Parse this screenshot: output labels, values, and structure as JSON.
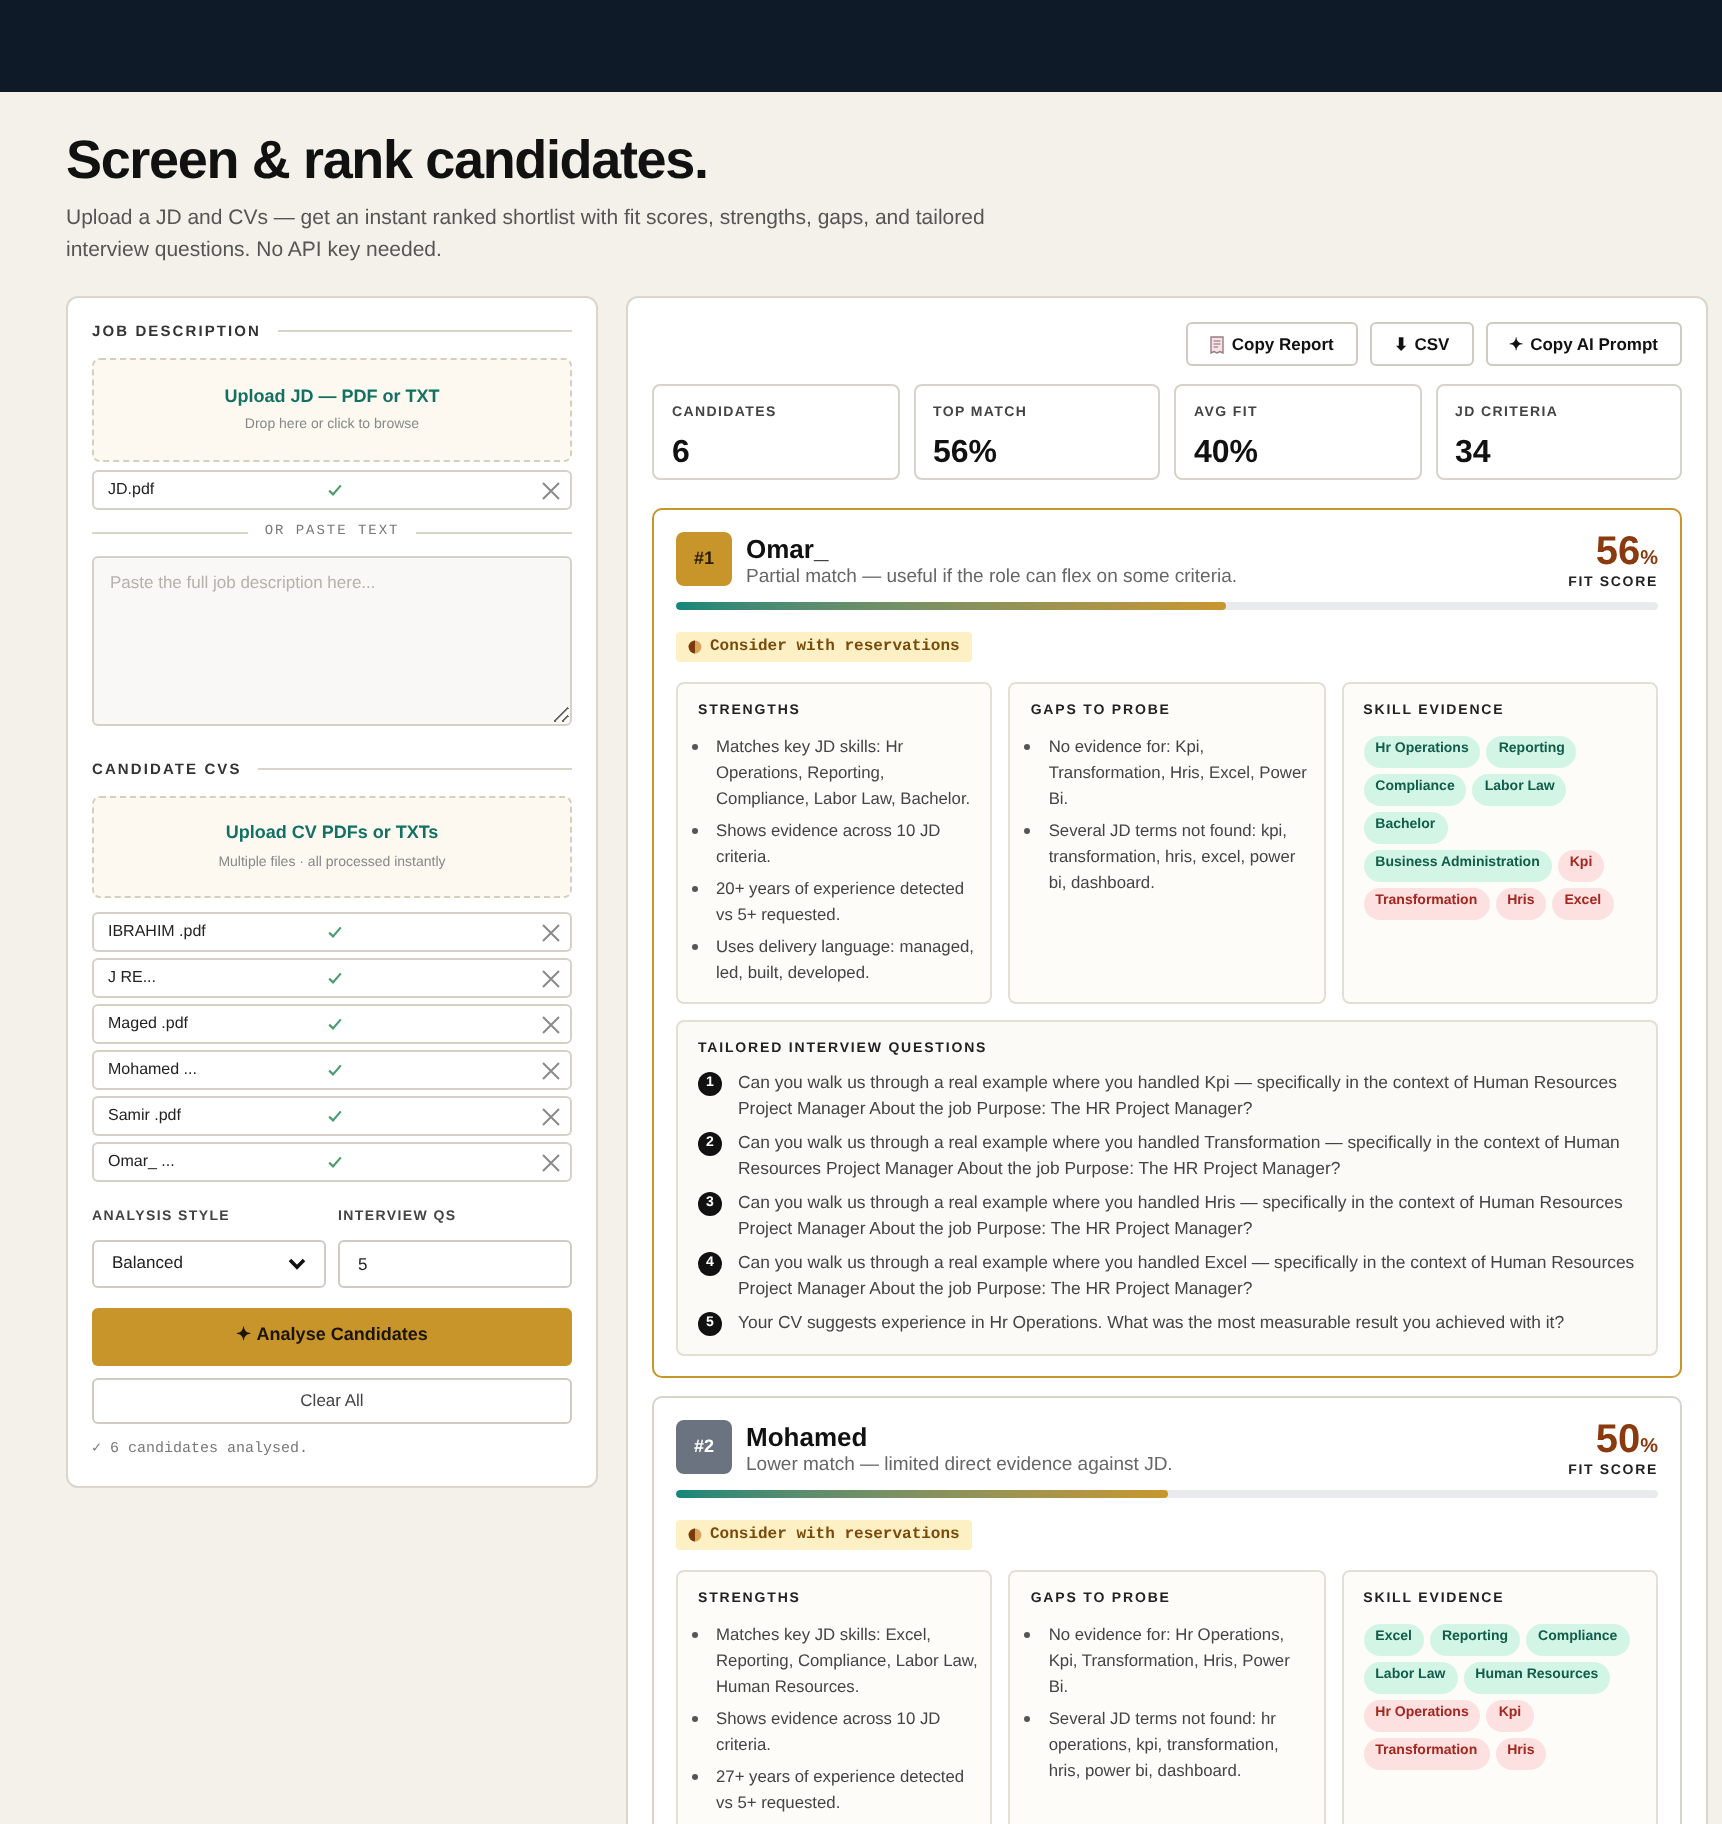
{
  "header": {
    "title": "Screen & rank candidates.",
    "subtitle": "Upload a JD and CVs — get an instant ranked shortlist with fit scores, strengths, gaps, and tailored interview questions. No API key needed."
  },
  "input_panel": {
    "jd_section": {
      "label": "JOB DESCRIPTION",
      "upload": {
        "title": "Upload JD — PDF or TXT",
        "hint": "Drop here or click to browse"
      },
      "files": [
        {
          "name": "JD.pdf",
          "processed": true
        }
      ],
      "divider": "OR PASTE TEXT",
      "textarea": {
        "placeholder": "Paste the full job description here..."
      }
    },
    "cv_section": {
      "label": "CANDIDATE CVS",
      "upload": {
        "title": "Upload CV PDFs or TXTs",
        "hint": "Multiple files · all processed instantly"
      },
      "files": [
        {
          "name": "IBRAHIM .pdf",
          "processed": true
        },
        {
          "name": "J RE...",
          "processed": true
        },
        {
          "name": "Maged .pdf",
          "processed": true
        },
        {
          "name": "Mohamed ...",
          "processed": true
        },
        {
          "name": "Samir .pdf",
          "processed": true
        },
        {
          "name": "Omar_ ...",
          "processed": true
        }
      ]
    },
    "analysis_style": {
      "label": "ANALYSIS STYLE",
      "value": "Balanced"
    },
    "interview_qs": {
      "label": "INTERVIEW QS",
      "value": "5"
    },
    "analyse_button": "✦ Analyse Candidates",
    "clear_button": "Clear All",
    "status": "✓ 6 candidates analysed."
  },
  "results": {
    "actions": [
      {
        "kind": "report",
        "label": "Copy Report"
      },
      {
        "kind": "plain",
        "label": "⬇ CSV"
      },
      {
        "kind": "plain",
        "label": "✦ Copy AI Prompt"
      }
    ],
    "stats": [
      {
        "label": "CANDIDATES",
        "value": "6"
      },
      {
        "label": "TOP MATCH",
        "value": "56%"
      },
      {
        "label": "AVG FIT",
        "value": "40%"
      },
      {
        "label": "JD CRITERIA",
        "value": "34"
      }
    ],
    "candidates": [
      {
        "rank": "#1",
        "highlighted": true,
        "name": "Omar_",
        "summary": "Partial match — useful if the role can flex on some criteria.",
        "score": "56",
        "score_unit": "%",
        "score_label": "FIT SCORE",
        "level": 0.56,
        "verdict": "Consider with reservations",
        "strengths": {
          "title": "STRENGTHS",
          "items": [
            "Matches key JD skills: Hr Operations, Reporting, Compliance, Labor Law, Bachelor.",
            "Shows evidence across 10 JD criteria.",
            "20+ years of experience detected vs 5+ requested.",
            "Uses delivery language: managed, led, built, developed."
          ]
        },
        "gaps": {
          "title": "GAPS TO PROBE",
          "items": [
            "No evidence for: Kpi, Transformation, Hris, Excel, Power Bi.",
            "Several JD terms not found: kpi, transformation, hris, excel, power bi, dashboard."
          ]
        },
        "skills": {
          "title": "SKILL EVIDENCE",
          "tags": [
            {
              "label": "Hr Operations",
              "found": true
            },
            {
              "label": "Reporting",
              "found": true
            },
            {
              "label": "Compliance",
              "found": true
            },
            {
              "label": "Labor Law",
              "found": true
            },
            {
              "label": "Bachelor",
              "found": true
            },
            {
              "label": "Business Administration",
              "found": true
            },
            {
              "label": "Kpi",
              "found": false
            },
            {
              "label": "Transformation",
              "found": false
            },
            {
              "label": "Hris",
              "found": false
            },
            {
              "label": "Excel",
              "found": false
            }
          ]
        },
        "questions": {
          "title": "TAILORED INTERVIEW QUESTIONS",
          "items": [
            {
              "number": "1",
              "text": "Can you walk us through a real example where you handled Kpi — specifically in the context of Human Resources Project Manager About the job Purpose: The HR Project Manager?"
            },
            {
              "number": "2",
              "text": "Can you walk us through a real example where you handled Transformation — specifically in the context of Human Resources Project Manager About the job Purpose: The HR Project Manager?"
            },
            {
              "number": "3",
              "text": "Can you walk us through a real example where you handled Hris — specifically in the context of Human Resources Project Manager About the job Purpose: The HR Project Manager?"
            },
            {
              "number": "4",
              "text": "Can you walk us through a real example where you handled Excel — specifically in the context of Human Resources Project Manager About the job Purpose: The HR Project Manager?"
            },
            {
              "number": "5",
              "text": "Your CV suggests experience in Hr Operations. What was the most measurable result you achieved with it?"
            }
          ]
        }
      },
      {
        "rank": "#2",
        "highlighted": false,
        "name": "Mohamed",
        "summary": "Lower match — limited direct evidence against JD.",
        "score": "50",
        "score_unit": "%",
        "score_label": "FIT SCORE",
        "level": 0.5,
        "verdict": "Consider with reservations",
        "strengths": {
          "title": "STRENGTHS",
          "items": [
            "Matches key JD skills: Excel, Reporting, Compliance, Labor Law, Human Resources.",
            "Shows evidence across 10 JD criteria.",
            "27+ years of experience detected vs 5+ requested."
          ]
        },
        "gaps": {
          "title": "GAPS TO PROBE",
          "items": [
            "No evidence for: Hr Operations, Kpi, Transformation, Hris, Power Bi.",
            "Several JD terms not found: hr operations, kpi, transformation, hris, power bi, dashboard."
          ]
        },
        "skills": {
          "title": "SKILL EVIDENCE",
          "tags": [
            {
              "label": "Excel",
              "found": true
            },
            {
              "label": "Reporting",
              "found": true
            },
            {
              "label": "Compliance",
              "found": true
            },
            {
              "label": "Labor Law",
              "found": true
            },
            {
              "label": "Human Resources",
              "found": true
            },
            {
              "label": "Hr Operations",
              "found": false
            },
            {
              "label": "Kpi",
              "found": false
            },
            {
              "label": "Transformation",
              "found": false
            },
            {
              "label": "Hris",
              "found": false
            }
          ]
        }
      }
    ]
  }
}
